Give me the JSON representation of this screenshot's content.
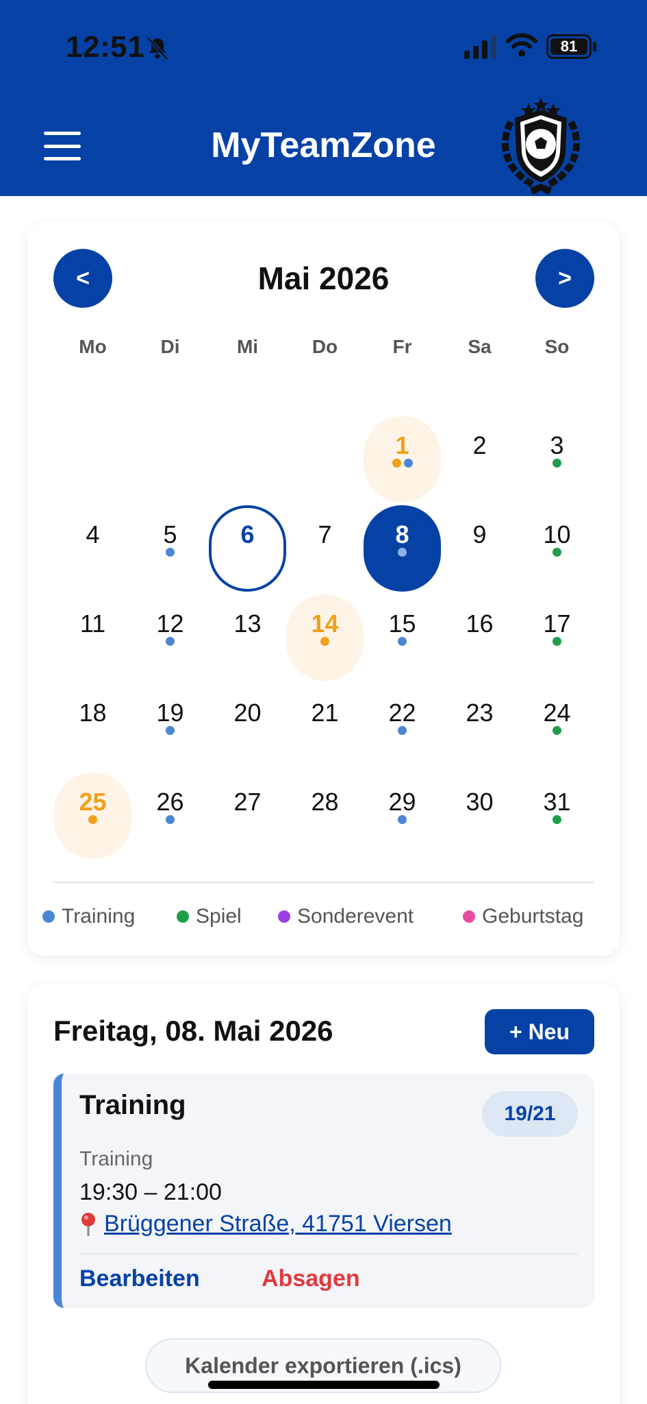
{
  "status_bar": {
    "time": "12:51",
    "battery": "81"
  },
  "app": {
    "title": "MyTeamZone"
  },
  "colors": {
    "brand": "#0642a6",
    "training": "#4a86d4",
    "spiel": "#1f9e4a",
    "sonderevent": "#9b3fe0",
    "geburtstag": "#e84c9e",
    "orange": "#f0a01a",
    "orange_bg": "#fdf3e7",
    "cancel": "#e0393e"
  },
  "calendar": {
    "prev_label": "<",
    "next_label": ">",
    "month_title": "Mai 2026",
    "weekdays": [
      "Mo",
      "Di",
      "Mi",
      "Do",
      "Fr",
      "Sa",
      "So"
    ],
    "days": [
      {
        "day": "1",
        "col": 4,
        "row": 0,
        "state": "birthday",
        "dots": [
          "orange",
          "training"
        ]
      },
      {
        "day": "2",
        "col": 5,
        "row": 0,
        "state": "",
        "dots": []
      },
      {
        "day": "3",
        "col": 6,
        "row": 0,
        "state": "",
        "dots": [
          "spiel"
        ]
      },
      {
        "day": "4",
        "col": 0,
        "row": 1,
        "state": "",
        "dots": []
      },
      {
        "day": "5",
        "col": 1,
        "row": 1,
        "state": "",
        "dots": [
          "training"
        ]
      },
      {
        "day": "6",
        "col": 2,
        "row": 1,
        "state": "today",
        "dots": []
      },
      {
        "day": "7",
        "col": 3,
        "row": 1,
        "state": "",
        "dots": []
      },
      {
        "day": "8",
        "col": 4,
        "row": 1,
        "state": "selected",
        "dots": [
          "training"
        ]
      },
      {
        "day": "9",
        "col": 5,
        "row": 1,
        "state": "",
        "dots": []
      },
      {
        "day": "10",
        "col": 6,
        "row": 1,
        "state": "",
        "dots": [
          "spiel"
        ]
      },
      {
        "day": "11",
        "col": 0,
        "row": 2,
        "state": "",
        "dots": []
      },
      {
        "day": "12",
        "col": 1,
        "row": 2,
        "state": "",
        "dots": [
          "training"
        ]
      },
      {
        "day": "13",
        "col": 2,
        "row": 2,
        "state": "",
        "dots": []
      },
      {
        "day": "14",
        "col": 3,
        "row": 2,
        "state": "birthday",
        "dots": [
          "orange"
        ]
      },
      {
        "day": "15",
        "col": 4,
        "row": 2,
        "state": "",
        "dots": [
          "training"
        ]
      },
      {
        "day": "16",
        "col": 5,
        "row": 2,
        "state": "",
        "dots": []
      },
      {
        "day": "17",
        "col": 6,
        "row": 2,
        "state": "",
        "dots": [
          "spiel"
        ]
      },
      {
        "day": "18",
        "col": 0,
        "row": 3,
        "state": "",
        "dots": []
      },
      {
        "day": "19",
        "col": 1,
        "row": 3,
        "state": "",
        "dots": [
          "training"
        ]
      },
      {
        "day": "20",
        "col": 2,
        "row": 3,
        "state": "",
        "dots": []
      },
      {
        "day": "21",
        "col": 3,
        "row": 3,
        "state": "",
        "dots": []
      },
      {
        "day": "22",
        "col": 4,
        "row": 3,
        "state": "",
        "dots": [
          "training"
        ]
      },
      {
        "day": "23",
        "col": 5,
        "row": 3,
        "state": "",
        "dots": []
      },
      {
        "day": "24",
        "col": 6,
        "row": 3,
        "state": "",
        "dots": [
          "spiel"
        ]
      },
      {
        "day": "25",
        "col": 0,
        "row": 4,
        "state": "birthday",
        "dots": [
          "orange"
        ]
      },
      {
        "day": "26",
        "col": 1,
        "row": 4,
        "state": "",
        "dots": [
          "training"
        ]
      },
      {
        "day": "27",
        "col": 2,
        "row": 4,
        "state": "",
        "dots": []
      },
      {
        "day": "28",
        "col": 3,
        "row": 4,
        "state": "",
        "dots": []
      },
      {
        "day": "29",
        "col": 4,
        "row": 4,
        "state": "",
        "dots": [
          "training"
        ]
      },
      {
        "day": "30",
        "col": 5,
        "row": 4,
        "state": "",
        "dots": []
      },
      {
        "day": "31",
        "col": 6,
        "row": 4,
        "state": "",
        "dots": [
          "spiel"
        ]
      }
    ],
    "legend": [
      {
        "label": "Training",
        "color": "training"
      },
      {
        "label": "Spiel",
        "color": "spiel"
      },
      {
        "label": "Sonderevent",
        "color": "sonderevent"
      },
      {
        "label": "Geburtstag",
        "color": "geburtstag"
      }
    ]
  },
  "detail": {
    "date_title": "Freitag, 08. Mai 2026",
    "new_label": "+ Neu",
    "event": {
      "title": "Training",
      "badge": "19/21",
      "type": "Training",
      "time": "19:30 – 21:00",
      "location": "Brüggener Straße, 41751 Viersen",
      "location_icon": "pin-icon",
      "edit_label": "Bearbeiten",
      "cancel_label": "Absagen"
    }
  },
  "export_label": "Kalender exportieren (.ics)"
}
